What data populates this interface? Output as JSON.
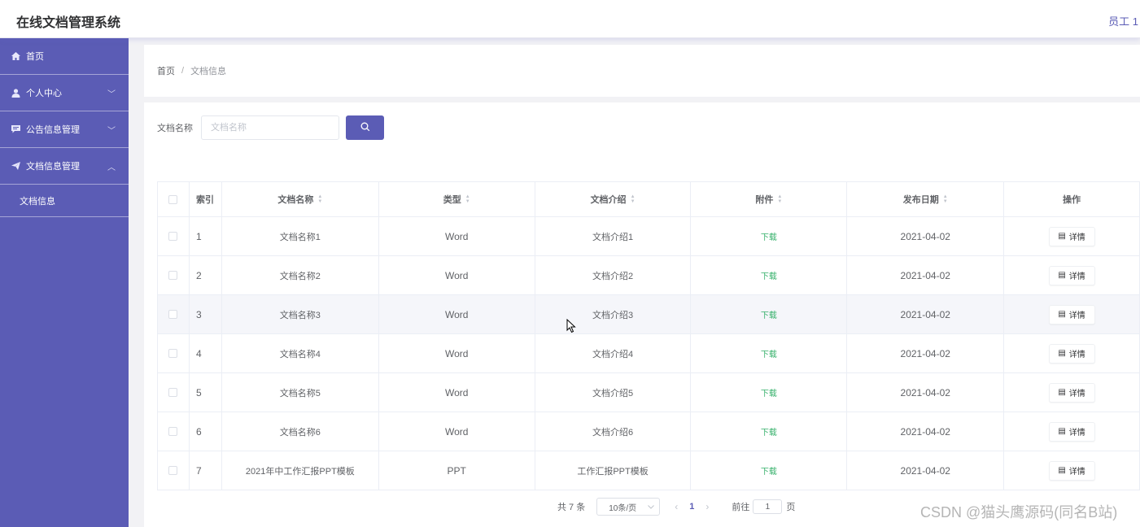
{
  "header": {
    "title": "在线文档管理系统",
    "user": "员工 1"
  },
  "sidebar": {
    "items": [
      {
        "label": "首页",
        "icon": "home-icon",
        "chevron": ""
      },
      {
        "label": "个人中心",
        "icon": "user-icon",
        "chevron": "﹀"
      },
      {
        "label": "公告信息管理",
        "icon": "chat-icon",
        "chevron": "﹀"
      },
      {
        "label": "文档信息管理",
        "icon": "send-icon",
        "chevron": "︿"
      }
    ],
    "subitems": [
      {
        "label": "文档信息"
      }
    ]
  },
  "breadcrumb": {
    "home": "首页",
    "separator": "/",
    "current": "文档信息"
  },
  "search": {
    "label": "文档名称",
    "placeholder": "文档名称",
    "value": ""
  },
  "table": {
    "columns": [
      "索引",
      "文档名称",
      "类型",
      "文档介绍",
      "附件",
      "发布日期",
      "操作"
    ],
    "rows": [
      {
        "index": "1",
        "name": "文档名称1",
        "type": "Word",
        "intro": "文档介绍1",
        "attachment": "下载",
        "date": "2021-04-02",
        "action": "详情"
      },
      {
        "index": "2",
        "name": "文档名称2",
        "type": "Word",
        "intro": "文档介绍2",
        "attachment": "下载",
        "date": "2021-04-02",
        "action": "详情"
      },
      {
        "index": "3",
        "name": "文档名称3",
        "type": "Word",
        "intro": "文档介绍3",
        "attachment": "下载",
        "date": "2021-04-02",
        "action": "详情"
      },
      {
        "index": "4",
        "name": "文档名称4",
        "type": "Word",
        "intro": "文档介绍4",
        "attachment": "下载",
        "date": "2021-04-02",
        "action": "详情"
      },
      {
        "index": "5",
        "name": "文档名称5",
        "type": "Word",
        "intro": "文档介绍5",
        "attachment": "下载",
        "date": "2021-04-02",
        "action": "详情"
      },
      {
        "index": "6",
        "name": "文档名称6",
        "type": "Word",
        "intro": "文档介绍6",
        "attachment": "下载",
        "date": "2021-04-02",
        "action": "详情"
      },
      {
        "index": "7",
        "name": "2021年中工作汇报PPT模板",
        "type": "PPT",
        "intro": "工作汇报PPT模板",
        "attachment": "下载",
        "date": "2021-04-02",
        "action": "详情"
      }
    ]
  },
  "pagination": {
    "total": "共 7 条",
    "page_size": "10条/页",
    "current_page": "1",
    "goto_prefix": "前往",
    "goto_value": "1",
    "goto_suffix": "页",
    "prev": "‹",
    "next": "›"
  },
  "watermark": "CSDN @猫头鹰源码(同名B站)",
  "colors": {
    "primary": "#5b5cb5",
    "download": "#35b06a",
    "background": "#f2f2f5"
  }
}
